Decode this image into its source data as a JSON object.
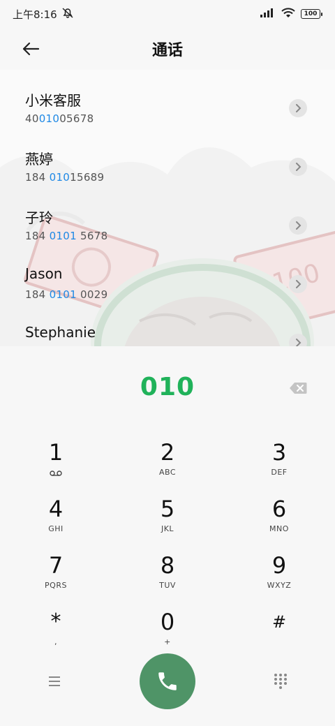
{
  "status": {
    "time": "上午8:16",
    "battery": "100"
  },
  "header": {
    "title": "通话"
  },
  "contacts": [
    {
      "name": "小米客服",
      "num_pre": "40",
      "num_hl": "010",
      "num_post": "05678"
    },
    {
      "name": "燕婷",
      "num_pre": "184 ",
      "num_hl": "010",
      "num_post": "15689"
    },
    {
      "name": "子玲",
      "num_pre": "184 ",
      "num_hl": "0101",
      "num_post": " 5678"
    },
    {
      "name": "Jason",
      "num_pre": "184 ",
      "num_hl": "0101",
      "num_post": " 0029"
    },
    {
      "name": "Stephanie",
      "num_pre": "",
      "num_hl": "",
      "num_post": ""
    }
  ],
  "dialer": {
    "digits": "010"
  },
  "keys": [
    {
      "d": "1",
      "l": ""
    },
    {
      "d": "2",
      "l": "ABC"
    },
    {
      "d": "3",
      "l": "DEF"
    },
    {
      "d": "4",
      "l": "GHI"
    },
    {
      "d": "5",
      "l": "JKL"
    },
    {
      "d": "6",
      "l": "MNO"
    },
    {
      "d": "7",
      "l": "PQRS"
    },
    {
      "d": "8",
      "l": "TUV"
    },
    {
      "d": "9",
      "l": "WXYZ"
    },
    {
      "d": "*",
      "l": ","
    },
    {
      "d": "0",
      "l": "+"
    },
    {
      "d": "#",
      "l": ""
    }
  ],
  "icons": {
    "back": "arrow-left-icon",
    "voicemail": "voicemail-icon",
    "backspace": "backspace-icon",
    "menu": "menu-icon",
    "call": "phone-icon",
    "dialpad": "dialpad-icon"
  },
  "colors": {
    "digits": "#20b25a",
    "highlight": "#1e88e5",
    "call": "#4f9467"
  }
}
